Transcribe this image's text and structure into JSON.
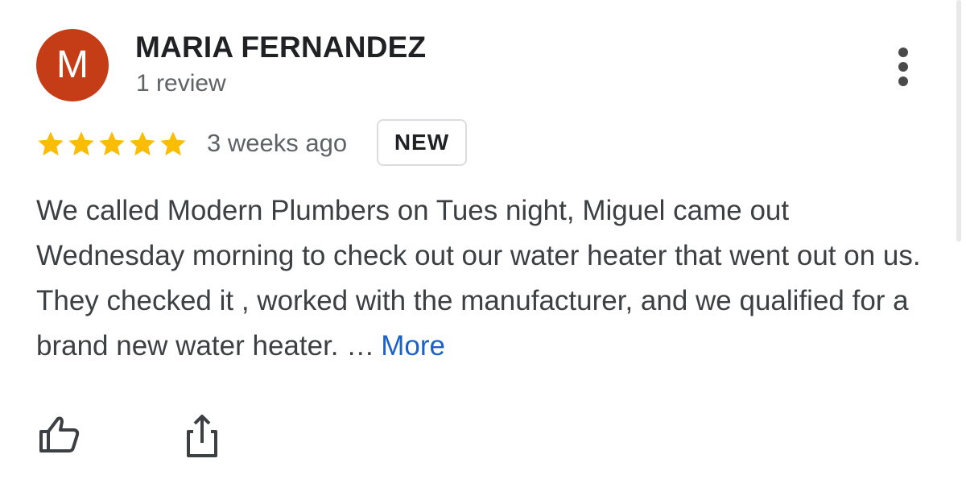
{
  "reviewer": {
    "avatar_letter": "M",
    "avatar_color": "#c43d17",
    "name": "MARIA FERNANDEZ",
    "review_count": "1 review"
  },
  "review": {
    "rating": 5,
    "max_rating": 5,
    "star_color": "#fbbc04",
    "time": "3 weeks ago",
    "badge": "NEW",
    "text": "We called Modern Plumbers on Tues night, Miguel came out Wednesday morning to check out our water heater that went out on us. They checked it , worked with the manufacturer, and we qualified for a brand new water heater. …",
    "more_label": "More",
    "link_color": "#1a62c9"
  },
  "actions": {
    "like_icon": "thumbs-up-icon",
    "share_icon": "share-icon",
    "menu_icon": "more-vert-icon"
  }
}
